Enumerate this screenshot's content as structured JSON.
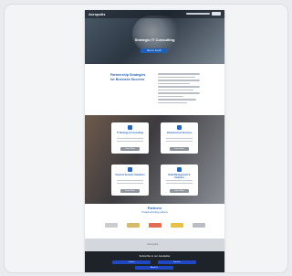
{
  "hero": {
    "logo": "Acropolis",
    "title": "Strategic IT Consulting",
    "cta": "Get in touch"
  },
  "intro": {
    "title": "Partnership Strategies for Business Success"
  },
  "services": [
    {
      "title": "IT Strategy & Consulting",
      "button": "Learn More"
    },
    {
      "title": "Infrastructure Services",
      "button": "Learn More"
    },
    {
      "title": "Cloud & Security Solutions",
      "button": "Learn More"
    },
    {
      "title": "Data Management & Analytics",
      "button": "Learn More"
    }
  ],
  "partners": {
    "title": "Partners",
    "subtitle": "Trusted technology partners"
  },
  "footer": {
    "logo": "Acropolis",
    "title": "Subscribe to our newsletter",
    "buttons": [
      "Contact",
      "Services",
      "About Us"
    ]
  },
  "colors": {
    "accent": "#2a66b8",
    "footer": "#1e2329",
    "button": "#2047c4"
  }
}
